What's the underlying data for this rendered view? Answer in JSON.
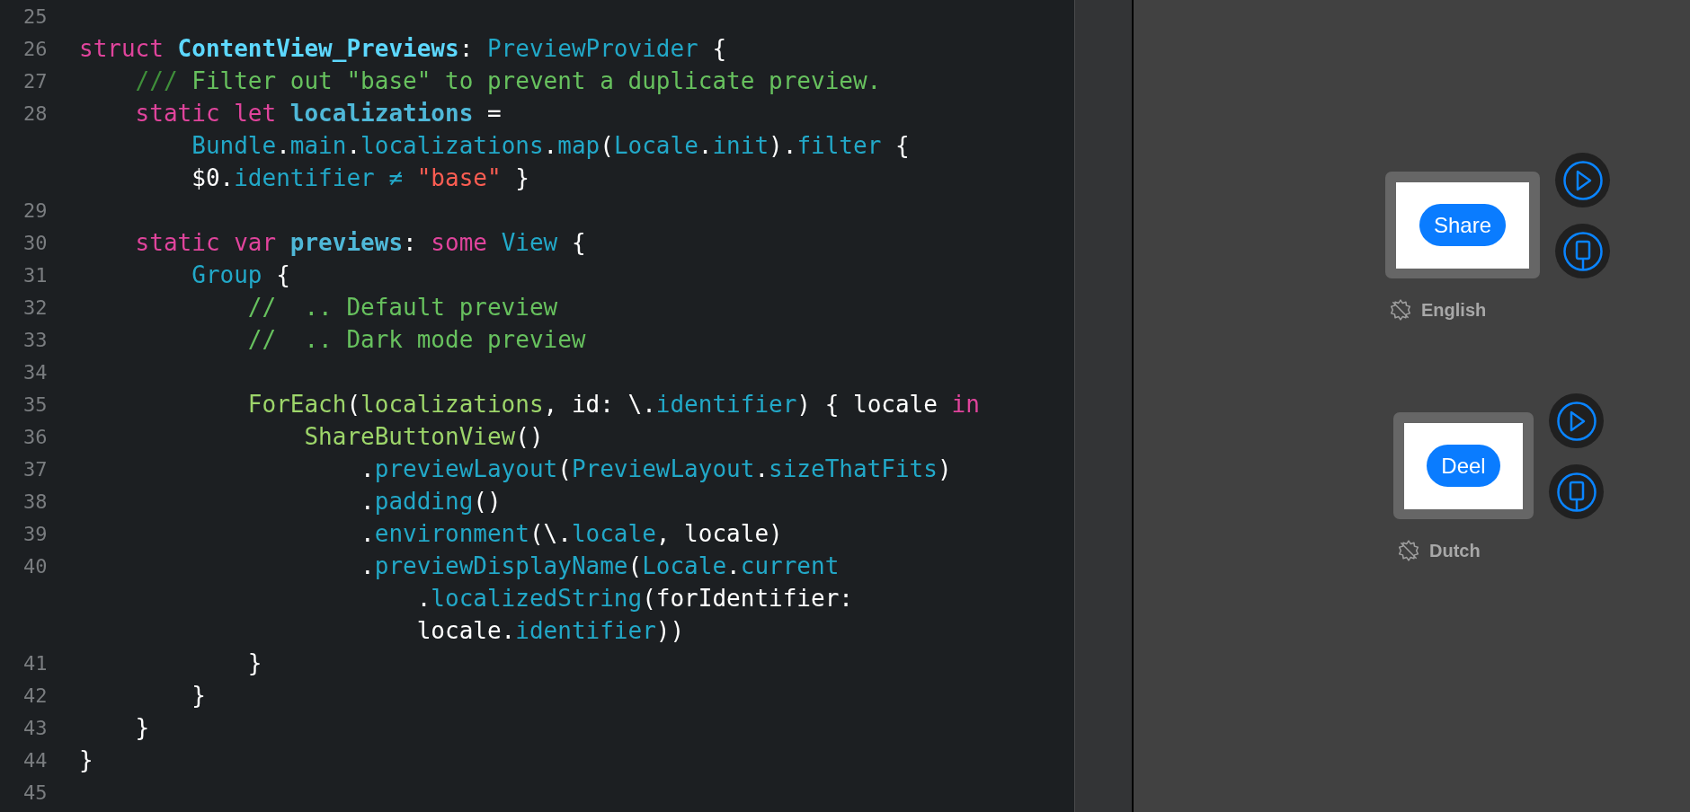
{
  "editor": {
    "lines": [
      {
        "number": "25"
      },
      {
        "number": "26",
        "rows": [
          {
            "segments": [
              {
                "text": "struct ",
                "kind": "keyword"
              },
              {
                "text": "ContentView_Previews",
                "kind": "declaration"
              },
              {
                "text": ": ",
                "kind": "plain"
              },
              {
                "text": "PreviewProvider",
                "kind": "type"
              },
              {
                "text": " {",
                "kind": "plain"
              }
            ]
          }
        ]
      },
      {
        "number": "27",
        "rows": [
          {
            "segments": [
              {
                "text": "    ///",
                "kind": "comment_marker"
              },
              {
                "text": " Filter out \"base\" to prevent a duplicate preview.",
                "kind": "comment"
              }
            ]
          }
        ]
      },
      {
        "number": "28",
        "rows": [
          {
            "segments": [
              {
                "text": "    static let ",
                "kind": "keyword"
              },
              {
                "text": "localizations",
                "kind": "declaration_member"
              },
              {
                "text": " =",
                "kind": "plain"
              }
            ]
          },
          {
            "segments": [
              {
                "text": "        Bundle",
                "kind": "type"
              },
              {
                "text": ".",
                "kind": "plain"
              },
              {
                "text": "main",
                "kind": "type"
              },
              {
                "text": ".",
                "kind": "plain"
              },
              {
                "text": "localizations",
                "kind": "type"
              },
              {
                "text": ".",
                "kind": "plain"
              },
              {
                "text": "map",
                "kind": "type"
              },
              {
                "text": "(",
                "kind": "plain"
              },
              {
                "text": "Locale",
                "kind": "type"
              },
              {
                "text": ".",
                "kind": "plain"
              },
              {
                "text": "init",
                "kind": "type"
              },
              {
                "text": ").",
                "kind": "plain"
              },
              {
                "text": "filter",
                "kind": "type"
              },
              {
                "text": " {",
                "kind": "plain"
              }
            ]
          },
          {
            "segments": [
              {
                "text": "        $0.",
                "kind": "plain"
              },
              {
                "text": "identifier",
                "kind": "type"
              },
              {
                "text": " ≠ ",
                "kind": "type"
              },
              {
                "text": "\"base\"",
                "kind": "string"
              },
              {
                "text": " }",
                "kind": "plain"
              }
            ]
          }
        ]
      },
      {
        "number": "29"
      },
      {
        "number": "30",
        "rows": [
          {
            "segments": [
              {
                "text": "    static var ",
                "kind": "keyword"
              },
              {
                "text": "previews",
                "kind": "declaration_member"
              },
              {
                "text": ": ",
                "kind": "plain"
              },
              {
                "text": "some ",
                "kind": "keyword"
              },
              {
                "text": "View",
                "kind": "type"
              },
              {
                "text": " {",
                "kind": "plain"
              }
            ]
          }
        ]
      },
      {
        "number": "31",
        "rows": [
          {
            "segments": [
              {
                "text": "        Group",
                "kind": "type"
              },
              {
                "text": " {",
                "kind": "plain"
              }
            ]
          }
        ]
      },
      {
        "number": "32",
        "rows": [
          {
            "segments": [
              {
                "text": "            //  .. Default preview",
                "kind": "comment"
              }
            ]
          }
        ]
      },
      {
        "number": "33",
        "rows": [
          {
            "segments": [
              {
                "text": "            //  .. Dark mode preview",
                "kind": "comment"
              }
            ]
          }
        ]
      },
      {
        "number": "34"
      },
      {
        "number": "35",
        "rows": [
          {
            "segments": [
              {
                "text": "            ForEach",
                "kind": "project"
              },
              {
                "text": "(",
                "kind": "plain"
              },
              {
                "text": "localizations",
                "kind": "project"
              },
              {
                "text": ", id: \\.",
                "kind": "plain"
              },
              {
                "text": "identifier",
                "kind": "type"
              },
              {
                "text": ") { locale ",
                "kind": "plain"
              },
              {
                "text": "in",
                "kind": "keyword"
              }
            ]
          }
        ]
      },
      {
        "number": "36",
        "rows": [
          {
            "segments": [
              {
                "text": "                ShareButtonView",
                "kind": "project"
              },
              {
                "text": "()",
                "kind": "plain"
              }
            ]
          }
        ]
      },
      {
        "number": "37",
        "rows": [
          {
            "segments": [
              {
                "text": "                    .previewLayout",
                "kind": "dotted_member"
              },
              {
                "text": "(",
                "kind": "plain"
              },
              {
                "text": "PreviewLayout",
                "kind": "type"
              },
              {
                "text": ".",
                "kind": "plain"
              },
              {
                "text": "sizeThatFits",
                "kind": "type"
              },
              {
                "text": ")",
                "kind": "plain"
              }
            ]
          }
        ]
      },
      {
        "number": "38",
        "rows": [
          {
            "segments": [
              {
                "text": "                    .padding",
                "kind": "dotted_member"
              },
              {
                "text": "()",
                "kind": "plain"
              }
            ]
          }
        ]
      },
      {
        "number": "39",
        "rows": [
          {
            "segments": [
              {
                "text": "                    .environment",
                "kind": "dotted_member"
              },
              {
                "text": "(\\.",
                "kind": "plain"
              },
              {
                "text": "locale",
                "kind": "type"
              },
              {
                "text": ", locale)",
                "kind": "plain"
              }
            ]
          }
        ]
      },
      {
        "number": "40",
        "rows": [
          {
            "segments": [
              {
                "text": "                    .previewDisplayName",
                "kind": "dotted_member"
              },
              {
                "text": "(",
                "kind": "plain"
              },
              {
                "text": "Locale",
                "kind": "type"
              },
              {
                "text": ".",
                "kind": "plain"
              },
              {
                "text": "current",
                "kind": "type"
              }
            ]
          },
          {
            "segments": [
              {
                "text": "                        .localizedString",
                "kind": "dotted_member"
              },
              {
                "text": "(forIdentifier:",
                "kind": "plain"
              }
            ]
          },
          {
            "segments": [
              {
                "text": "                        locale.",
                "kind": "plain"
              },
              {
                "text": "identifier",
                "kind": "type"
              },
              {
                "text": "))",
                "kind": "plain"
              }
            ]
          }
        ]
      },
      {
        "number": "41",
        "rows": [
          {
            "segments": [
              {
                "text": "            }",
                "kind": "plain"
              }
            ]
          }
        ]
      },
      {
        "number": "42",
        "rows": [
          {
            "segments": [
              {
                "text": "        }",
                "kind": "plain"
              }
            ]
          }
        ]
      },
      {
        "number": "43",
        "rows": [
          {
            "segments": [
              {
                "text": "    }",
                "kind": "plain"
              }
            ]
          }
        ]
      },
      {
        "number": "44",
        "rows": [
          {
            "segments": [
              {
                "text": "}",
                "kind": "plain"
              }
            ]
          }
        ]
      },
      {
        "number": "45"
      }
    ]
  },
  "previews": [
    {
      "button_label": "Share",
      "name": "English"
    },
    {
      "button_label": "Deel",
      "name": "Dutch"
    }
  ]
}
